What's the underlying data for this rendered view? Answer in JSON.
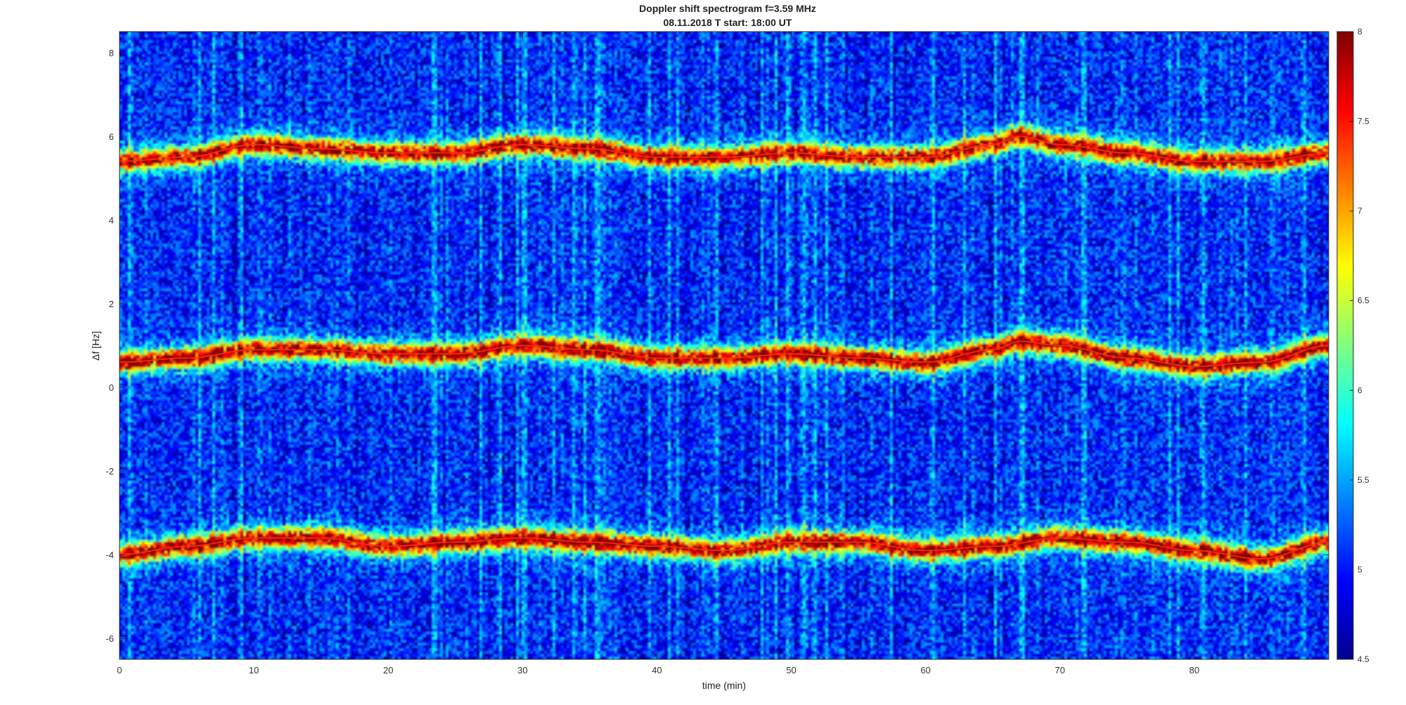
{
  "chart_data": {
    "type": "heatmap",
    "title": "Doppler shift spectrogram f=3.59 MHz",
    "subtitle": "08.11.2018   T start: 18:00 UT",
    "xlabel": "time (min)",
    "ylabel": "Δf [Hz]",
    "xlim": [
      0,
      90
    ],
    "ylim": [
      -6.5,
      8.5
    ],
    "xticks": [
      "0",
      "10",
      "20",
      "30",
      "40",
      "50",
      "60",
      "70",
      "80"
    ],
    "yticks": [
      "-6",
      "-4",
      "-2",
      "0",
      "2",
      "4",
      "6",
      "8"
    ],
    "colorbar": {
      "colormap": "jet",
      "clim": [
        4.5,
        8
      ],
      "ticks": [
        "4.5",
        "5",
        "5.5",
        "6",
        "6.5",
        "7",
        "7.5",
        "8"
      ]
    },
    "background_level": 5.0,
    "series": [
      {
        "x": [
          0,
          5,
          10,
          15,
          20,
          25,
          30,
          35,
          40,
          45,
          50,
          55,
          60,
          65,
          67,
          70,
          75,
          80,
          85,
          90
        ],
        "y": [
          5.4,
          5.5,
          5.8,
          5.7,
          5.6,
          5.6,
          5.8,
          5.7,
          5.5,
          5.5,
          5.6,
          5.5,
          5.5,
          5.8,
          6.0,
          5.8,
          5.6,
          5.4,
          5.4,
          5.6
        ],
        "peak_level": 7.5
      },
      {
        "x": [
          0,
          5,
          10,
          15,
          20,
          25,
          30,
          35,
          40,
          45,
          50,
          55,
          60,
          65,
          67,
          70,
          75,
          80,
          85,
          90
        ],
        "y": [
          0.6,
          0.7,
          0.9,
          0.9,
          0.8,
          0.8,
          1.0,
          0.9,
          0.7,
          0.7,
          0.8,
          0.7,
          0.6,
          0.9,
          1.1,
          1.0,
          0.7,
          0.5,
          0.6,
          1.0
        ],
        "peak_level": 7.6
      },
      {
        "x": [
          0,
          5,
          10,
          15,
          20,
          25,
          30,
          35,
          40,
          45,
          50,
          55,
          60,
          65,
          70,
          75,
          80,
          85,
          90
        ],
        "y": [
          -4.0,
          -3.8,
          -3.6,
          -3.6,
          -3.8,
          -3.7,
          -3.6,
          -3.7,
          -3.8,
          -3.9,
          -3.7,
          -3.7,
          -3.9,
          -3.8,
          -3.6,
          -3.7,
          -3.9,
          -4.1,
          -3.7
        ],
        "peak_level": 7.6
      }
    ]
  }
}
